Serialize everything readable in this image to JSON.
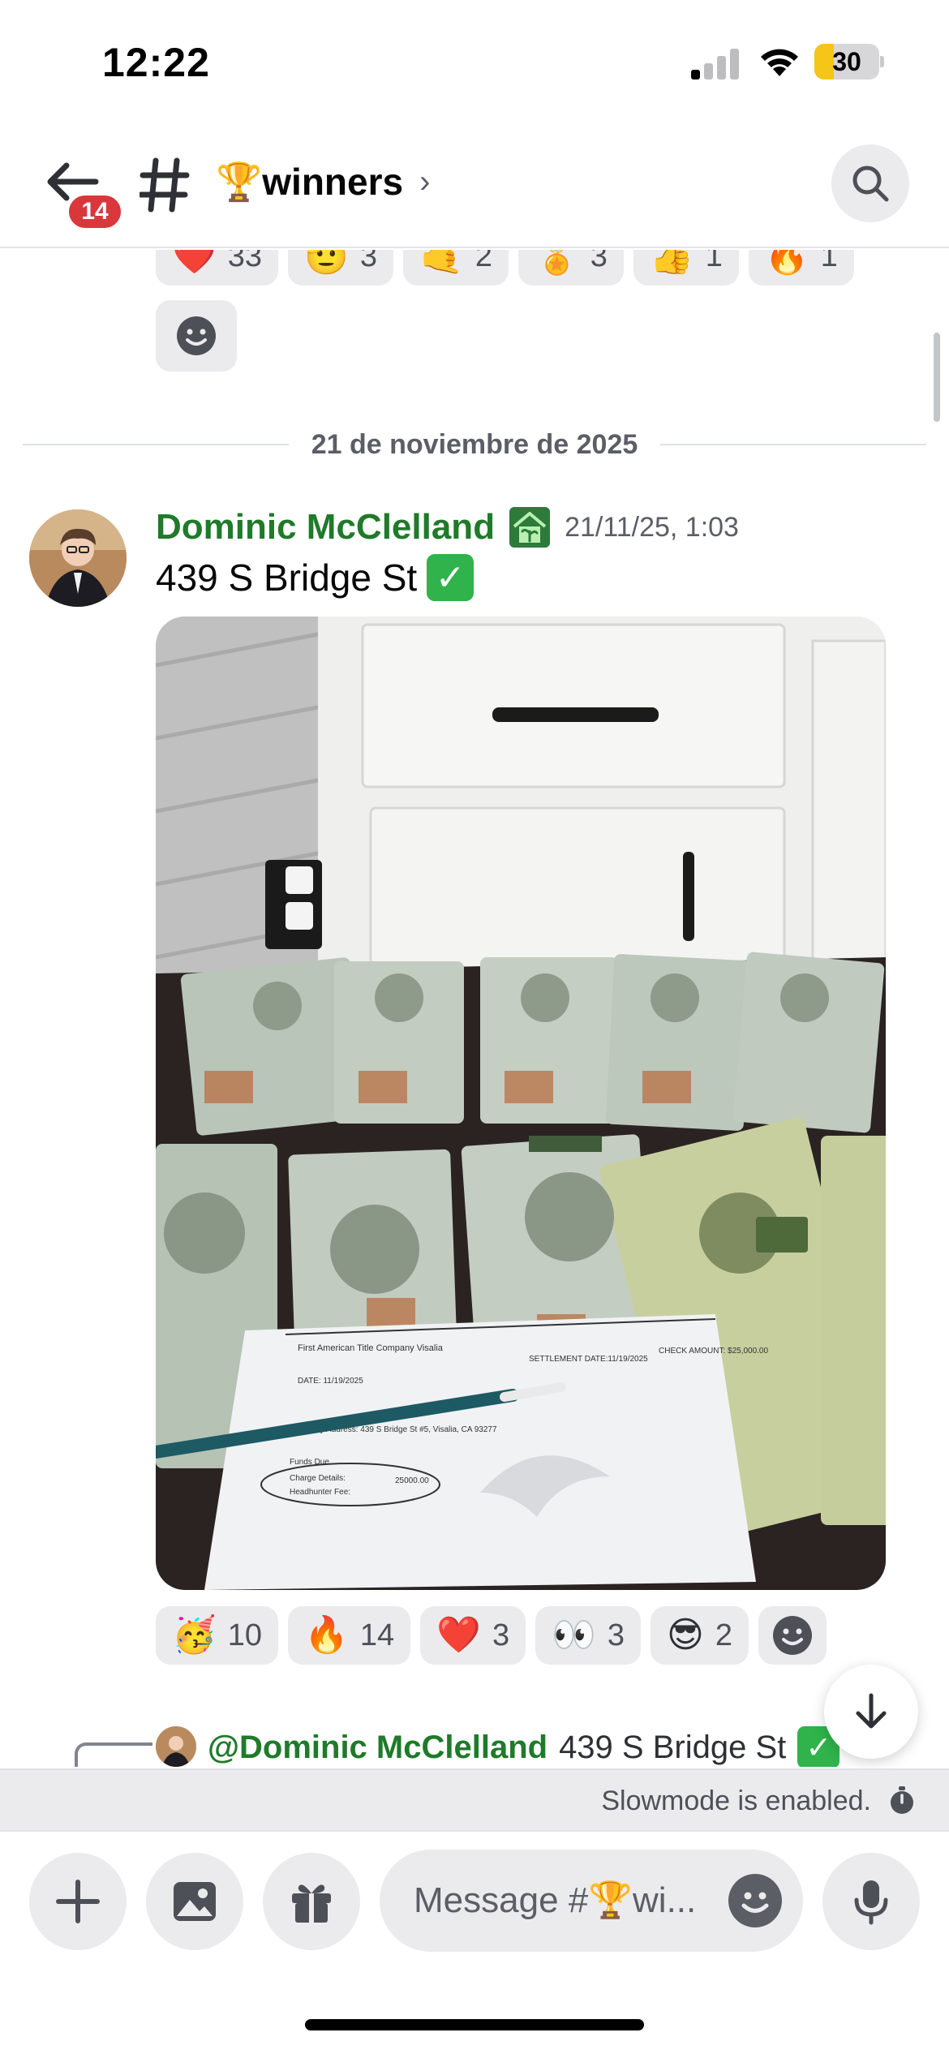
{
  "status_bar": {
    "time": "12:22",
    "battery": "30",
    "battery_level": 0.3
  },
  "header": {
    "back_badge": "14",
    "channel": "🏆winners",
    "chevron": "›"
  },
  "top_reactions": [
    {
      "emoji": "❤️",
      "count": "33"
    },
    {
      "emoji": "🫡",
      "count": "3"
    },
    {
      "emoji": "🤙",
      "count": "2"
    },
    {
      "emoji": "🏅",
      "count": "3"
    },
    {
      "emoji": "👍",
      "count": "1"
    },
    {
      "emoji": "🔥",
      "count": "1"
    }
  ],
  "date_divider": "21 de noviembre de 2025",
  "message": {
    "author": "Dominic McClelland",
    "timestamp": "21/11/25, 1:03",
    "text": "439 S Bridge St",
    "check": "✓",
    "image_caption_lines": [
      "First American Title Company Visalia",
      "DATE: 11/19/2025",
      "SETTLEMENT DATE:11/19/2025",
      "CHECK AMOUNT: $25,000.00",
      "Property Address: 439 S Bridge St #5, Visalia, CA 93277",
      "Funds Due",
      "Charge Details:",
      "Headhunter Fee:",
      "25000.00"
    ]
  },
  "message_reactions": [
    {
      "emoji": "🥳",
      "count": "10"
    },
    {
      "emoji": "🔥",
      "count": "14"
    },
    {
      "emoji": "❤️",
      "count": "3"
    },
    {
      "emoji": "👀",
      "count": "3"
    },
    {
      "emoji": "😎",
      "count": "2"
    }
  ],
  "reply": {
    "mention": "@Dominic McClelland",
    "text": "439 S Bridge St",
    "check": "✓"
  },
  "slowmode": "Slowmode is enabled.",
  "composer": {
    "placeholder": "Message #🏆wi..."
  }
}
